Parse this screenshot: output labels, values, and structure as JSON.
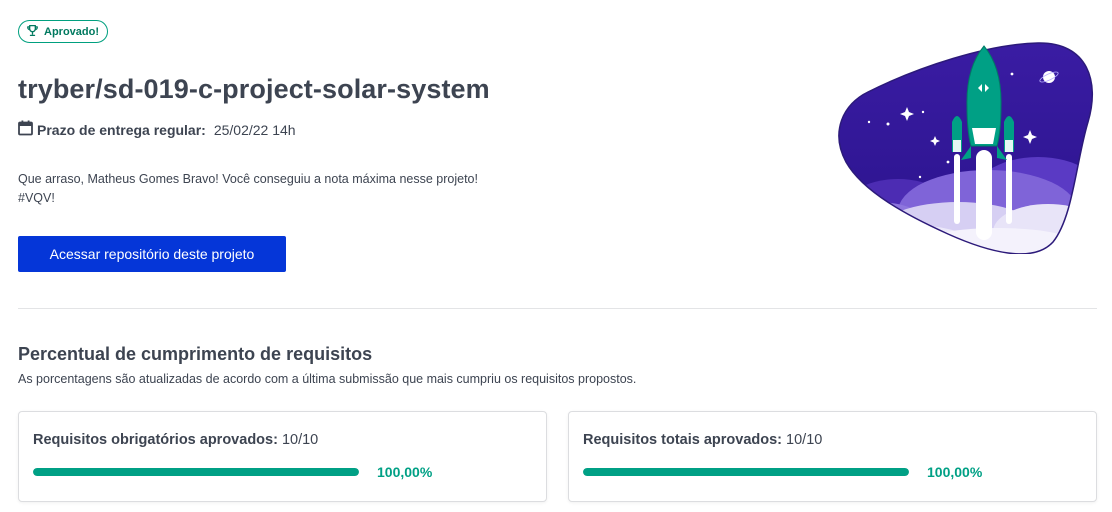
{
  "status_badge": {
    "label": "Aprovado!",
    "icon": "trophy-icon"
  },
  "project": {
    "title": "tryber/sd-019-c-project-solar-system",
    "deadline_label": "Prazo de entrega regular:",
    "deadline_value": "25/02/22 14h",
    "message_line1": "Que arraso, Matheus Gomes Bravo! Você conseguiu a nota máxima nesse projeto!",
    "message_line2": "#VQV!",
    "repo_button_label": "Acessar repositório deste projeto"
  },
  "requirements": {
    "title": "Percentual de cumprimento de requisitos",
    "subtitle": "As porcentagens são atualizadas de acordo com a última submissão que mais cumpriu os requisitos propostos.",
    "cards": [
      {
        "label": "Requisitos obrigatórios aprovados:",
        "count": "10/10",
        "percent_text": "100,00%",
        "progress": 1.0
      },
      {
        "label": "Requisitos totais aprovados:",
        "count": "10/10",
        "percent_text": "100,00%",
        "progress": 1.0
      }
    ]
  },
  "colors": {
    "accent_green": "#00a085",
    "button_blue": "#0536d8",
    "text": "#3d4451",
    "illustration_purple": "#3a1da0"
  }
}
